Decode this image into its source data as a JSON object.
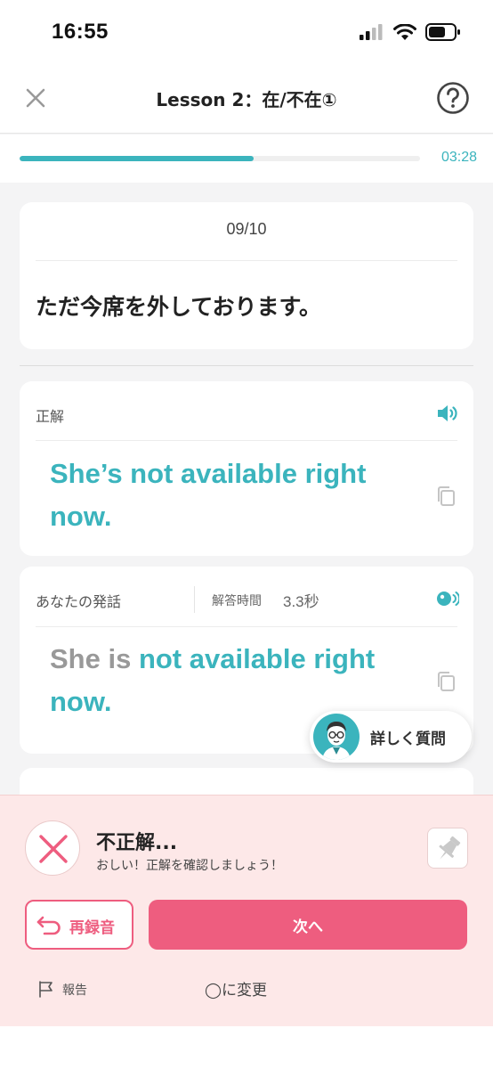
{
  "status_bar": {
    "time": "16:55",
    "icons": [
      "cellular-signal-icon",
      "wifi-icon",
      "battery-icon"
    ]
  },
  "nav": {
    "title": "Lesson 2：在/不在①",
    "close_icon": "close-icon",
    "help_icon": "help-icon"
  },
  "progress": {
    "fraction": 0.585,
    "timer": "03:28"
  },
  "question": {
    "counter": "09/10",
    "text": "ただ今席を外しております。"
  },
  "correct_answer": {
    "label": "正解",
    "text": "She’s not available right now."
  },
  "your_speech": {
    "label": "あなたの発話",
    "time_label": "解答時間",
    "time_value": "3.3秒",
    "wrong_part": "She is ",
    "correct_part": "not available right now."
  },
  "ask_button": {
    "label": "詳しく質問"
  },
  "result": {
    "title": "不正解...",
    "subtitle": "おしい！正解を確認しましょう！",
    "rerecord_label": "再録音",
    "next_label": "次へ",
    "report_label": "報告",
    "change_label": "◯に変更"
  },
  "colors": {
    "accent_teal": "#3bb4bd",
    "accent_pink": "#ee5d7f",
    "result_background": "#fde8e8"
  }
}
